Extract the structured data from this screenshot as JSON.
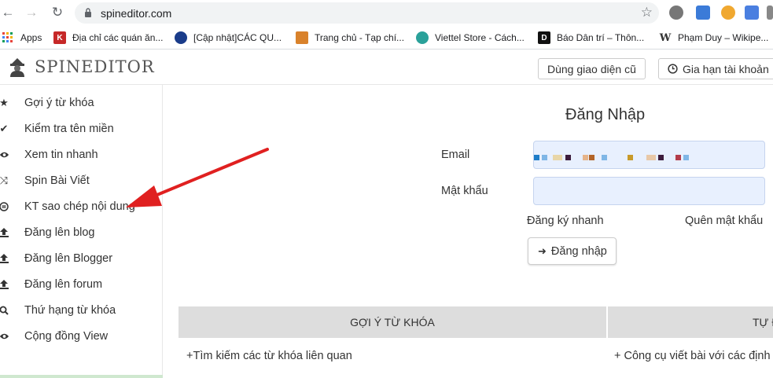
{
  "browser": {
    "url": "spineditor.com",
    "bookmarks": [
      {
        "label": "Apps",
        "icon": "apps-grid-icon",
        "color": "#e8453c"
      },
      {
        "label": "Địa chỉ các quán ăn...",
        "icon": "k-favicon",
        "color": "#c62828"
      },
      {
        "label": "[Cập nhật]CÁC QU...",
        "icon": "circle-favicon",
        "color": "#1a3c8a"
      },
      {
        "label": "Trang chủ - Tạp chí...",
        "icon": "house-favicon",
        "color": "#d9822b"
      },
      {
        "label": "Viettel Store - Cách...",
        "icon": "viettel-favicon",
        "color": "#2aa19a"
      },
      {
        "label": "Báo Dân trí – Thôn...",
        "icon": "d-favicon",
        "color": "#111111"
      },
      {
        "label": "Phạm Duy – Wikipe...",
        "icon": "wikipedia-icon",
        "color": "#333333"
      }
    ]
  },
  "site": {
    "brand": "SPINEDITOR",
    "btn_old_ui": "Dùng giao diện cũ",
    "btn_renew": "Gia hạn tài khoản"
  },
  "sidebar": {
    "items": [
      {
        "label": "Gợi ý từ khóa",
        "icon": "star-icon"
      },
      {
        "label": "Kiểm tra tên miền",
        "icon": "check-icon"
      },
      {
        "label": "Xem tin nhanh",
        "icon": "eye-icon"
      },
      {
        "label": "Spin Bài Viết",
        "icon": "shuffle-icon"
      },
      {
        "label": "KT sao chép nội dung",
        "icon": "copyright-icon"
      },
      {
        "label": "Đăng lên blog",
        "icon": "upload-icon"
      },
      {
        "label": "Đăng lên Blogger",
        "icon": "upload-icon"
      },
      {
        "label": "Đăng lên forum",
        "icon": "upload-icon"
      },
      {
        "label": "Thứ hạng từ khóa",
        "icon": "search-icon"
      },
      {
        "label": "Cộng đồng View",
        "icon": "eye-icon"
      }
    ]
  },
  "login": {
    "title": "Đăng Nhập",
    "email_label": "Email",
    "password_label": "Mật khẩu",
    "quick_register": "Đăng ký nhanh",
    "forgot_password": "Quên mật khẩu",
    "submit": "Đăng nhập"
  },
  "features": {
    "col1_header": "GỢI Ý TỪ KHÓA",
    "col2_header": "TỰ Đ",
    "col1_row1": "+Tìm kiếm các từ khóa liên quan",
    "col2_row1": "+ Công cụ viết bài với các định d"
  },
  "colors": {
    "autofill": "#e8f0fe",
    "table_header": "#dddddd",
    "annotation_arrow": "#e02020"
  }
}
